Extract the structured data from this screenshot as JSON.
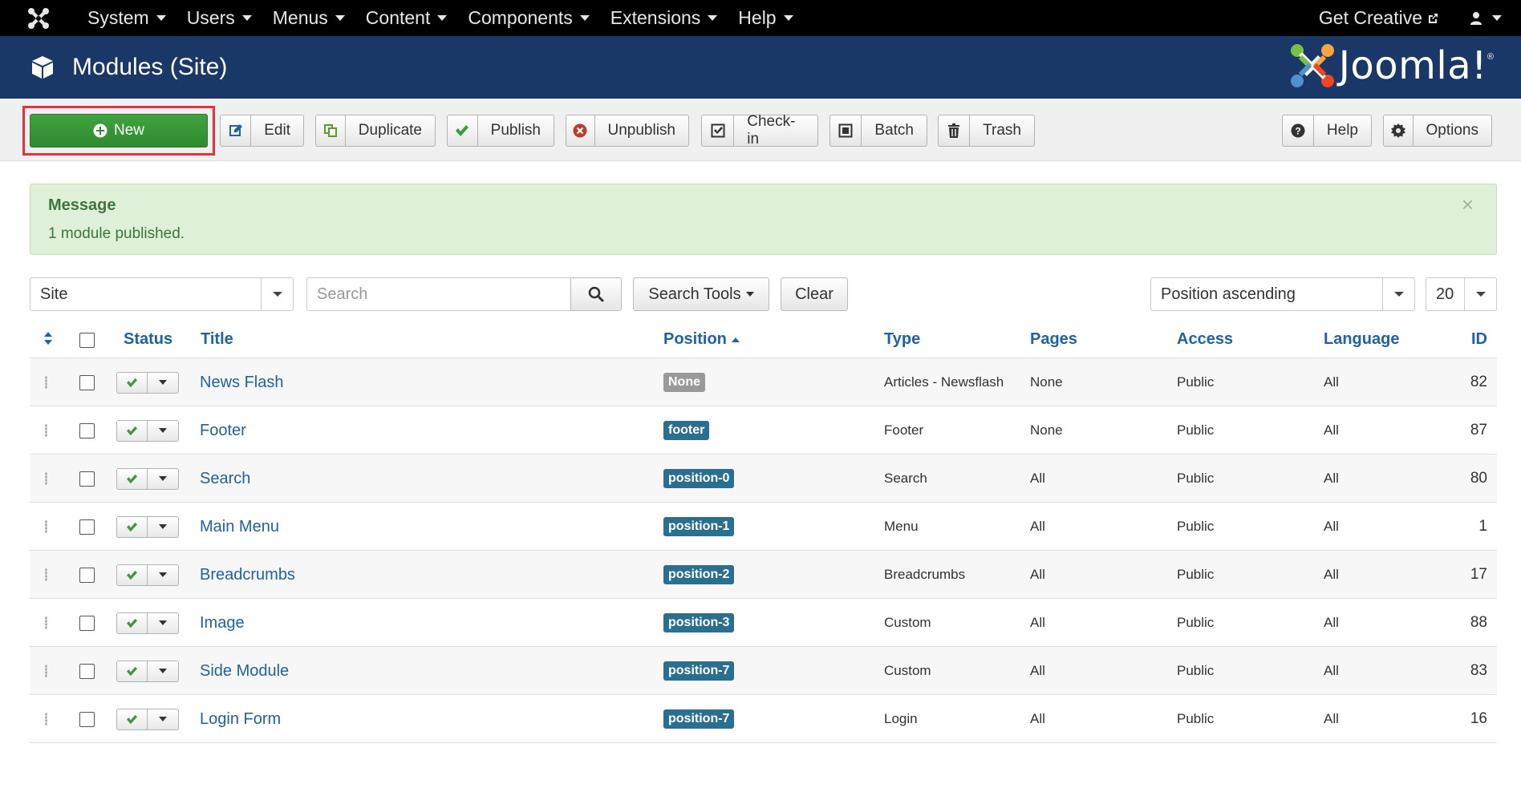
{
  "topnav": {
    "menus": [
      "System",
      "Users",
      "Menus",
      "Content",
      "Components",
      "Extensions",
      "Help"
    ],
    "get_creative": "Get Creative"
  },
  "header": {
    "title": "Modules (Site)",
    "brand": "Joomla!"
  },
  "toolbar": {
    "new": "New",
    "edit": "Edit",
    "duplicate": "Duplicate",
    "publish": "Publish",
    "unpublish": "Unpublish",
    "checkin": "Check-in",
    "batch": "Batch",
    "trash": "Trash",
    "help": "Help",
    "options": "Options"
  },
  "alert": {
    "heading": "Message",
    "text": "1 module published.",
    "close": "×"
  },
  "filters": {
    "client": "Site",
    "search_placeholder": "Search",
    "search_tools": "Search Tools",
    "clear": "Clear",
    "ordering": "Position ascending",
    "limit": "20"
  },
  "table": {
    "headers": {
      "status": "Status",
      "title": "Title",
      "position": "Position",
      "type": "Type",
      "pages": "Pages",
      "access": "Access",
      "language": "Language",
      "id": "ID"
    },
    "rows": [
      {
        "title": "News Flash",
        "position": "None",
        "type": "Articles - Newsflash",
        "pages": "None",
        "access": "Public",
        "language": "All",
        "id": "82"
      },
      {
        "title": "Footer",
        "position": "footer",
        "type": "Footer",
        "pages": "None",
        "access": "Public",
        "language": "All",
        "id": "87"
      },
      {
        "title": "Search",
        "position": "position-0",
        "type": "Search",
        "pages": "All",
        "access": "Public",
        "language": "All",
        "id": "80"
      },
      {
        "title": "Main Menu",
        "position": "position-1",
        "type": "Menu",
        "pages": "All",
        "access": "Public",
        "language": "All",
        "id": "1"
      },
      {
        "title": "Breadcrumbs",
        "position": "position-2",
        "type": "Breadcrumbs",
        "pages": "All",
        "access": "Public",
        "language": "All",
        "id": "17"
      },
      {
        "title": "Image",
        "position": "position-3",
        "type": "Custom",
        "pages": "All",
        "access": "Public",
        "language": "All",
        "id": "88"
      },
      {
        "title": "Side Module",
        "position": "position-7",
        "type": "Custom",
        "pages": "All",
        "access": "Public",
        "language": "All",
        "id": "83"
      },
      {
        "title": "Login Form",
        "position": "position-7",
        "type": "Login",
        "pages": "All",
        "access": "Public",
        "language": "All",
        "id": "16"
      }
    ]
  }
}
